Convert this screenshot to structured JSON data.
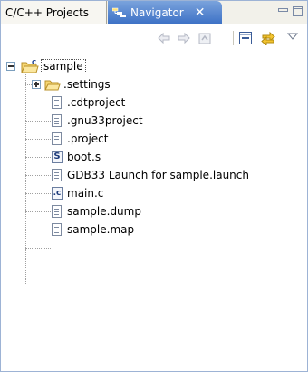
{
  "tabs": {
    "projects_label": "C/C++ Projects",
    "navigator_label": "Navigator",
    "close_glyph": "✕"
  },
  "tree": {
    "root": {
      "label": "sample",
      "icon": "c-project-folder-icon"
    },
    "items": [
      {
        "label": ".settings",
        "icon": "folder-icon",
        "expandable": true
      },
      {
        "label": ".cdtproject",
        "icon": "file-icon"
      },
      {
        "label": ".gnu33project",
        "icon": "file-icon"
      },
      {
        "label": ".project",
        "icon": "file-icon"
      },
      {
        "label": "boot.s",
        "icon": "assembly-file-icon",
        "letter": "S"
      },
      {
        "label": "GDB33 Launch for sample.launch",
        "icon": "file-icon"
      },
      {
        "label": "main.c",
        "icon": "c-file-icon",
        "letter": ".c"
      },
      {
        "label": "sample.dump",
        "icon": "file-icon"
      },
      {
        "label": "sample.map",
        "icon": "file-icon"
      }
    ]
  },
  "colors": {
    "active_tab": "#3e72c6",
    "tab_bar": "#f2f1ea",
    "view_border": "#9db3d5"
  }
}
